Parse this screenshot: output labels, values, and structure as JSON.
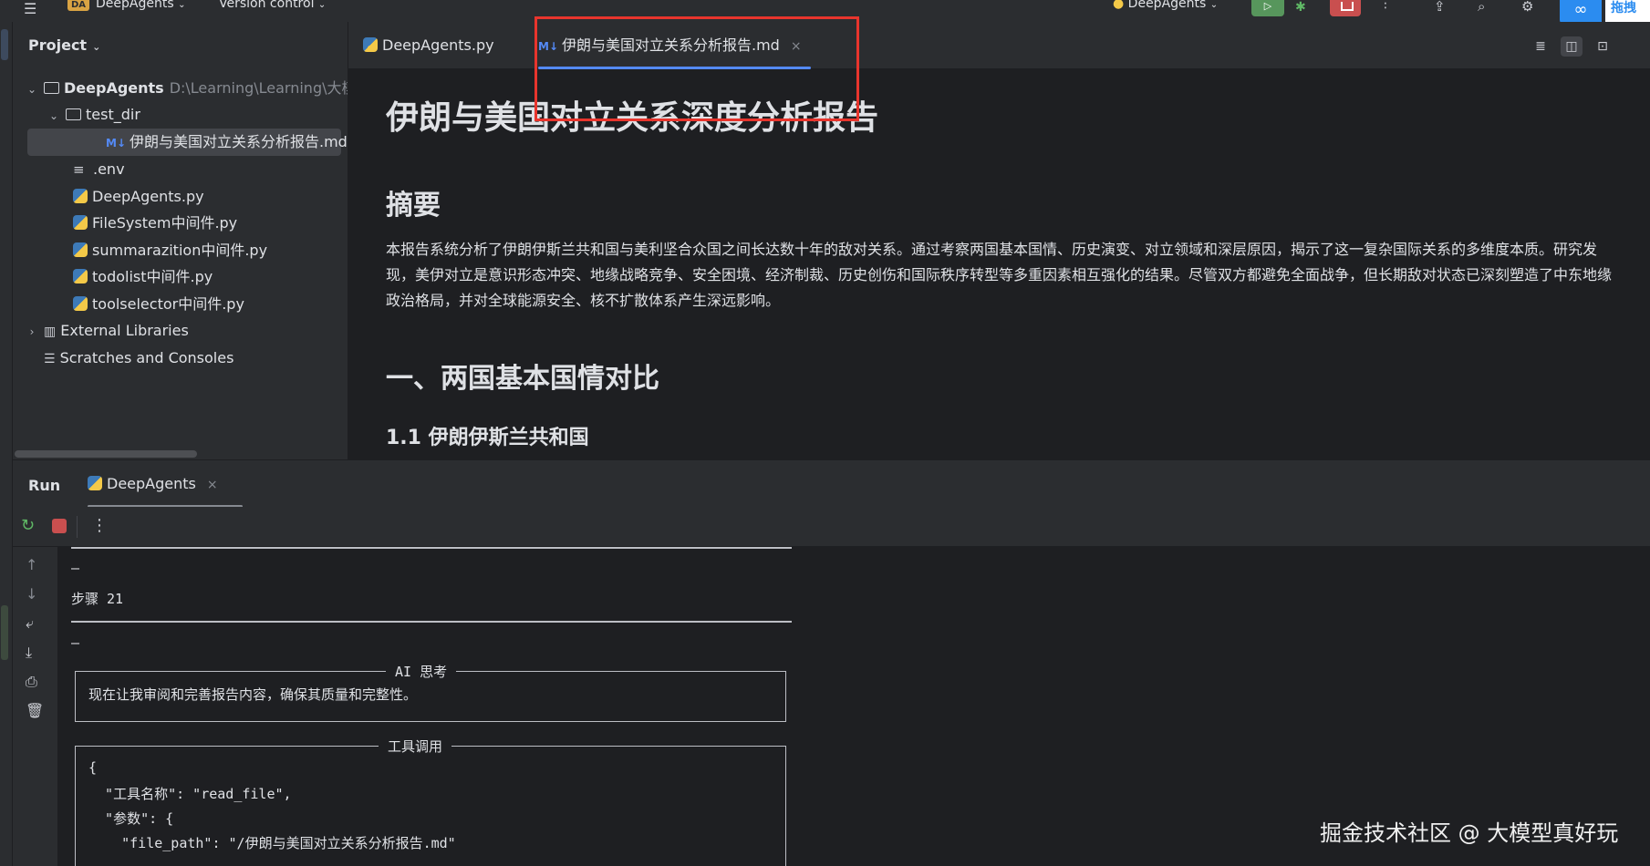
{
  "topbar": {
    "menu_icon": "hamburger-icon",
    "project_badge": "DA",
    "project_name": "DeepAgents",
    "version_control": "Version control",
    "run_config": "DeepAgents",
    "plugin_text": "拖拽"
  },
  "project_panel": {
    "title": "Project",
    "tree": [
      {
        "label": "DeepAgents",
        "path": "D:\\Learning\\Learning\\大模",
        "type": "folder",
        "expanded": true
      },
      {
        "label": "test_dir",
        "type": "folder",
        "expanded": true
      },
      {
        "label": "伊朗与美国对立关系分析报告.md",
        "type": "md",
        "selected": true
      },
      {
        "label": ".env",
        "type": "env"
      },
      {
        "label": "DeepAgents.py",
        "type": "py"
      },
      {
        "label": "FileSystem中间件.py",
        "type": "py"
      },
      {
        "label": "summarazition中间件.py",
        "type": "py"
      },
      {
        "label": "todolist中间件.py",
        "type": "py"
      },
      {
        "label": "toolselector中间件.py",
        "type": "py"
      },
      {
        "label": "External Libraries",
        "type": "lib",
        "expanded": false
      },
      {
        "label": "Scratches and Consoles",
        "type": "scratch"
      }
    ]
  },
  "editor_tabs": [
    {
      "label": "DeepAgents.py",
      "icon": "python-file-icon",
      "active": false
    },
    {
      "label": "伊朗与美国对立关系分析报告.md",
      "icon": "markdown-file-icon",
      "active": true,
      "close": "×"
    }
  ],
  "markdown": {
    "h1": "伊朗与美国对立关系深度分析报告",
    "summary_heading": "摘要",
    "summary_text": "本报告系统分析了伊朗伊斯兰共和国与美利坚合众国之间长达数十年的敌对关系。通过考察两国基本国情、历史演变、对立领域和深层原因，揭示了这一复杂国际关系的多维度本质。研究发现，美伊对立是意识形态冲突、地缘战略竞争、安全困境、经济制裁、历史创伤和国际秩序转型等多重因素相互强化的结果。尽管双方都避免全面战争，但长期敌对状态已深刻塑造了中东地缘政治格局，并对全球能源安全、核不扩散体系产生深远影响。",
    "section1": "一、两国基本国情对比",
    "section1_1": "1.1 伊朗伊斯兰共和国"
  },
  "run_panel": {
    "label": "Run",
    "tab": "DeepAgents",
    "tab_close": "×"
  },
  "console": {
    "dash1": "—",
    "step": "步骤 21",
    "dash2": "—",
    "ai_title": "AI 思考",
    "ai_text": "现在让我审阅和完善报告内容，确保其质量和完整性。",
    "tool_title": "工具调用",
    "json_lines": [
      "{",
      "  \"工具名称\": \"read_file\",",
      "  \"参数\": {",
      "    \"file_path\": \"/伊朗与美国对立关系分析报告.md\""
    ]
  },
  "watermark": "掘金技术社区 @ 大模型真好玩",
  "colors": {
    "accent": "#548af7",
    "highlight_box": "#e8352d",
    "run_green": "#57965c",
    "stop_red": "#c94f4f"
  }
}
